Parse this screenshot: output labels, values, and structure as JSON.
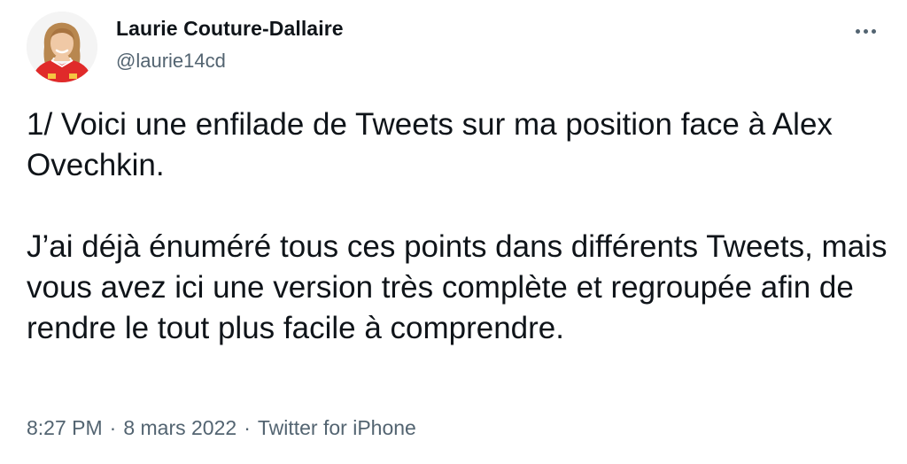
{
  "author": {
    "name": "Laurie Couture-Dallaire",
    "handle": "@laurie14cd",
    "avatar_icon": "profile-photo"
  },
  "menu": {
    "icon": "more-horizontal-icon"
  },
  "tweet": {
    "paragraphs": [
      "1/ Voici une enfilade de Tweets sur ma position face à Alex Ovechkin.",
      "J’ai déjà énuméré tous ces points dans différents Tweets, mais vous avez ici une version très complète et regroupée afin de rendre le tout plus facile à comprendre."
    ]
  },
  "meta": {
    "time": "8:27 PM",
    "date": "8 mars 2022",
    "source": "Twitter for iPhone",
    "separator": "·"
  },
  "colors": {
    "text": "#0f1419",
    "secondary": "#536471",
    "background": "#ffffff",
    "avatar_jersey": "#e02a2a"
  }
}
